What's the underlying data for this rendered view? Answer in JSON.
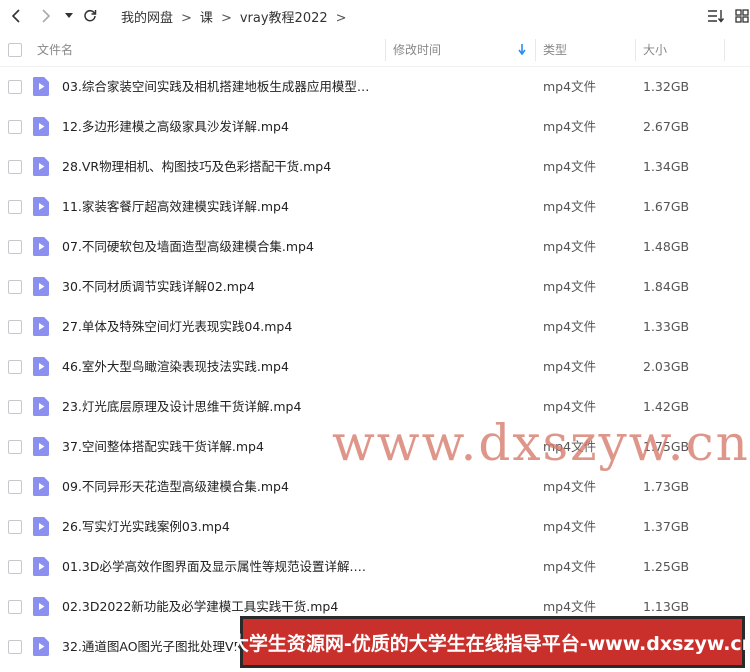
{
  "breadcrumb": [
    "我的网盘",
    "课",
    "vray教程2022"
  ],
  "columns": {
    "name": "文件名",
    "modified": "修改时间",
    "type": "类型",
    "size": "大小"
  },
  "files": [
    {
      "name": "03.综合家装空间实践及相机搭建地板生成器应用模型调...",
      "type": "mp4文件",
      "size": "1.32GB"
    },
    {
      "name": "12.多边形建模之高级家具沙发详解.mp4",
      "type": "mp4文件",
      "size": "2.67GB"
    },
    {
      "name": "28.VR物理相机、构图技巧及色彩搭配干货.mp4",
      "type": "mp4文件",
      "size": "1.34GB"
    },
    {
      "name": "11.家装客餐厅超高效建模实践详解.mp4",
      "type": "mp4文件",
      "size": "1.67GB"
    },
    {
      "name": "07.不同硬软包及墙面造型高级建模合集.mp4",
      "type": "mp4文件",
      "size": "1.48GB"
    },
    {
      "name": "30.不同材质调节实践详解02.mp4",
      "type": "mp4文件",
      "size": "1.84GB"
    },
    {
      "name": "27.单体及特殊空间灯光表现实践04.mp4",
      "type": "mp4文件",
      "size": "1.33GB"
    },
    {
      "name": "46.室外大型鸟瞰渲染表现技法实践.mp4",
      "type": "mp4文件",
      "size": "2.03GB"
    },
    {
      "name": "23.灯光底层原理及设计思维干货详解.mp4",
      "type": "mp4文件",
      "size": "1.42GB"
    },
    {
      "name": "37.空间整体搭配实践干货详解.mp4",
      "type": "mp4文件",
      "size": "1.75GB"
    },
    {
      "name": "09.不同异形天花造型高级建模合集.mp4",
      "type": "mp4文件",
      "size": "1.73GB"
    },
    {
      "name": "26.写实灯光实践案例03.mp4",
      "type": "mp4文件",
      "size": "1.37GB"
    },
    {
      "name": "01.3D必学高效作图界面及显示属性等规范设置详解.mp4",
      "type": "mp4文件",
      "size": "1.25GB"
    },
    {
      "name": "02.3D2022新功能及必学建模工具实践干货.mp4",
      "type": "mp4文件",
      "size": "1.13GB"
    },
    {
      "name": "32.通道图AO图光子图批处理VR...",
      "type": "",
      "size": ""
    }
  ],
  "watermark": "www.dxszyw.cn",
  "banner": "大学生资源网-优质的大学生在线指导平台-www.dxszyw.cn",
  "colors": {
    "file_icon": "#8b8ff0",
    "sort_arrow": "#2d8cf0",
    "banner_bg": "#c9302c"
  }
}
